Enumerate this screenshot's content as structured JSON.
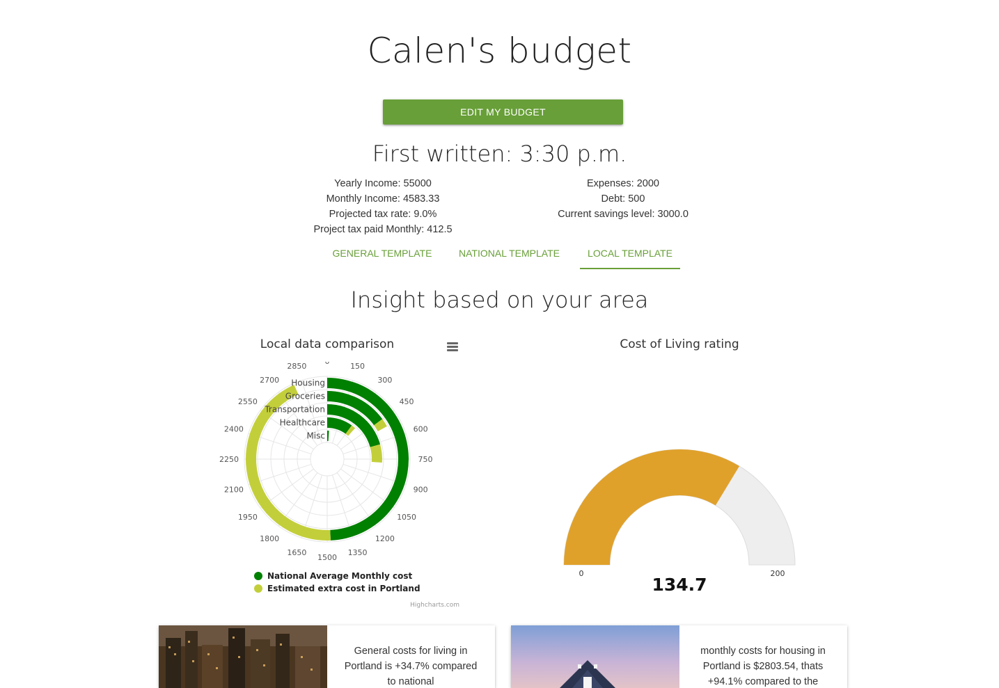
{
  "header": {
    "title": "Calen's budget",
    "edit_button": "EDIT MY BUDGET",
    "first_written": "First written: 3:30 p.m."
  },
  "stats": {
    "left": [
      "Yearly Income: 55000",
      "Monthly Income: 4583.33",
      "Projected tax rate: 9.0%",
      "Project tax paid Monthly: 412.5"
    ],
    "right": [
      "Expenses: 2000",
      "Debt: 500",
      "Current savings level: 3000.0"
    ]
  },
  "tabs": [
    {
      "label": "GENERAL TEMPLATE",
      "active": false
    },
    {
      "label": "NATIONAL TEMPLATE",
      "active": false
    },
    {
      "label": "LOCAL TEMPLATE",
      "active": true
    }
  ],
  "section_title": "Insight based on your area",
  "colors": {
    "accent": "#689f38",
    "national": "#008000",
    "extra": "#c3cf3a",
    "gauge_fill": "#e0a12b",
    "gauge_bg": "#eeeeee"
  },
  "chart_data": [
    {
      "type": "bar",
      "subtype": "polar-radial-stacked",
      "title": "Local data comparison",
      "categories": [
        "Housing",
        "Groceries",
        "Transportation",
        "Healthcare",
        "Misc"
      ],
      "series": [
        {
          "name": "National Average Monthly cost",
          "values": [
            1480,
            450,
            620,
            300,
            30
          ]
        },
        {
          "name": "Estimated extra cost in Portland",
          "values": [
            1320,
            60,
            160,
            50,
            0
          ]
        }
      ],
      "axis_ticks": [
        0,
        150,
        300,
        450,
        600,
        750,
        900,
        1050,
        1200,
        1350,
        1500,
        1650,
        1800,
        1950,
        2100,
        2250,
        2400,
        2550,
        2700,
        2850
      ],
      "ylim": [
        0,
        3000
      ],
      "credit": "Highcharts.com",
      "legend_position": "bottom-left"
    },
    {
      "type": "gauge",
      "title": "Cost of Living rating",
      "value": 134.7,
      "value_label": "134.7",
      "min": 0,
      "max": 200,
      "min_label": "0",
      "max_label": "200"
    }
  ],
  "cards": [
    {
      "text": "General costs for living in Portland is +34.7% compared to national",
      "image": "city-skyline-photo"
    },
    {
      "text": "monthly costs for housing in Portland is $2803.54, thats +94.1% compared to the",
      "image": "house-photo"
    }
  ]
}
